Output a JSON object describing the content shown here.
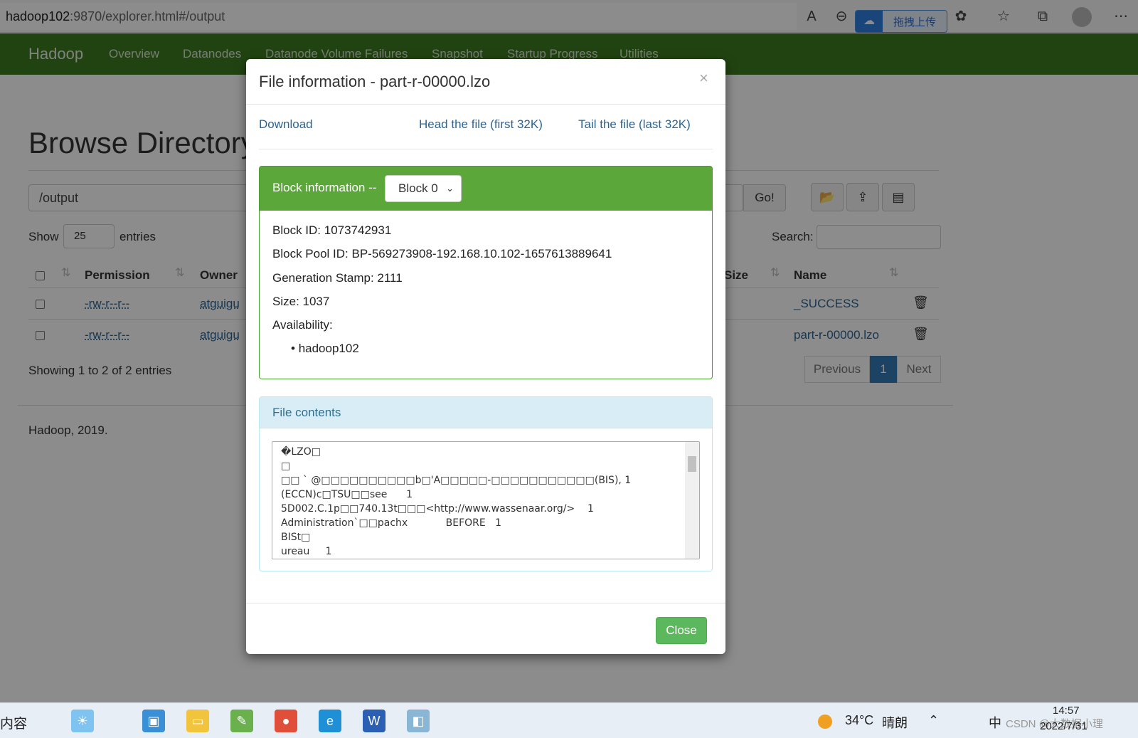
{
  "browser": {
    "url_host": "hadoop102",
    "url_rest": ":9870/explorer.html#/output",
    "upload_label": "拖拽上传",
    "icons": [
      "read-aloud-icon",
      "zoom-out-icon",
      "baidu-cloud-icon",
      "extensions-icon",
      "favorites-icon",
      "collections-icon",
      "profile-avatar",
      "more-icon"
    ]
  },
  "navbar": {
    "brand": "Hadoop",
    "items": [
      "Overview",
      "Datanodes",
      "Datanode Volume Failures",
      "Snapshot",
      "Startup Progress",
      "Utilities"
    ]
  },
  "page": {
    "title": "Browse Directory",
    "path": "/output",
    "go_label": "Go!",
    "show_label": "Show",
    "show_value": "25",
    "entries_label": "entries",
    "search_label": "Search:",
    "columns": [
      "Permission",
      "Owner",
      "Size",
      "Name"
    ],
    "rows": [
      {
        "permission": "-rw-r--r--",
        "owner": "atguigu",
        "name": "_SUCCESS"
      },
      {
        "permission": "-rw-r--r--",
        "owner": "atguigu",
        "name": "part-r-00000.lzo"
      }
    ],
    "showing": "Showing 1 to 2 of 2 entries",
    "pager": {
      "previous": "Previous",
      "current": "1",
      "next": "Next"
    },
    "footer": "Hadoop, 2019."
  },
  "modal": {
    "title": "File information - part-r-00000.lzo",
    "close_x": "×",
    "links": {
      "download": "Download",
      "head": "Head the file (first 32K)",
      "tail": "Tail the file (last 32K)"
    },
    "block_panel": {
      "label": "Block information --",
      "selected_block": "Block 0",
      "block_id": "Block ID: 1073742931",
      "pool_id": "Block Pool ID: BP-569273908-192.168.10.102-1657613889641",
      "gen_stamp": "Generation Stamp: 2111",
      "size": "Size: 1037",
      "availability_label": "Availability:",
      "availability_node": "hadoop102"
    },
    "contents_panel": {
      "label": "File contents",
      "lines": [
        "�LZO□",
        "□",
        "□□ ` @□□□□□□□□□□b□'A□□□□□-□□□□□□□□□□□(BIS), 1",
        "(ECCN)c□TSU□□see      1",
        "5D002.C.1p□□740.13t□□□<http://www.wassenaar.org/>    1",
        "Administration`□□pachx            BEFORE   1",
        "BISt□",
        "ureau     1"
      ]
    },
    "close_label": "Close"
  },
  "taskbar": {
    "left_text": "内容",
    "weather_temp": "34°C",
    "weather_desc": "晴朗",
    "ime": "中",
    "time": "14:57",
    "date": "2022/7/31",
    "watermark": "CSDN @大数据小理"
  }
}
